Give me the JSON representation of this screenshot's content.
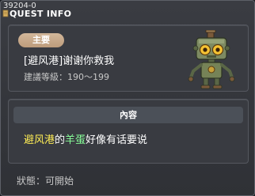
{
  "window": {
    "quest_id": "39204-0",
    "title": "QUEST INFO"
  },
  "summary": {
    "badge": "主要",
    "quest_name": "[避风港]谢谢你救我",
    "level_label": "建議等級：",
    "level_range": "190～199",
    "npc_icon": "robot-npc-icon"
  },
  "content": {
    "section_label": "內容",
    "desc": {
      "place": "避风港",
      "connector": "的",
      "npc": "羊蛋",
      "rest": "好像有话要说"
    }
  },
  "status": {
    "label": "狀態：",
    "value": "可開始"
  },
  "colors": {
    "place_highlight": "#ffee55",
    "npc_highlight": "#88ff99",
    "badge": "#c9aa8a"
  }
}
